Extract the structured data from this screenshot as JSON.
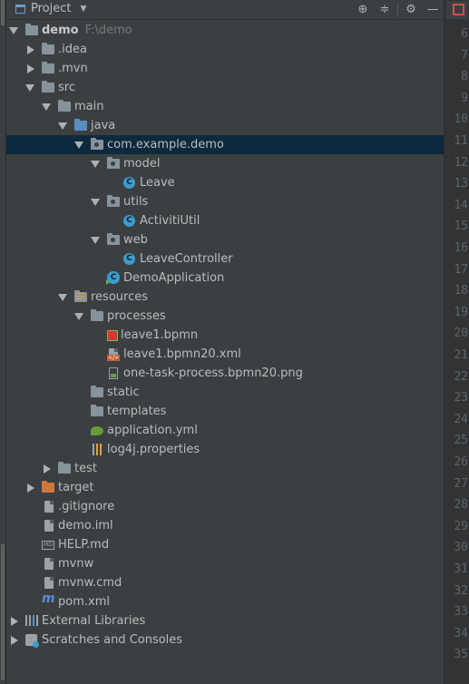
{
  "panel": {
    "title": "Project",
    "icons": [
      "locate-icon",
      "collapse-icon",
      "gear-icon",
      "hide-icon"
    ]
  },
  "tree": {
    "root": {
      "label": "demo",
      "path": "F:\\demo"
    },
    "idea": ".idea",
    "mvn": ".mvn",
    "src": "src",
    "main": "main",
    "java": "java",
    "package": "com.example.demo",
    "model": "model",
    "leave": "Leave",
    "utils": "utils",
    "activiti_util": "ActivitiUtil",
    "web": "web",
    "leave_controller": "LeaveController",
    "demo_application": "DemoApplication",
    "resources": "resources",
    "processes": "processes",
    "leave_bpmn": "leave1.bpmn",
    "leave_bpmn_xml": "leave1.bpmn20.xml",
    "png": "one-task-process.bpmn20.png",
    "static": "static",
    "templates": "templates",
    "app_yml": "application.yml",
    "log4j": "log4j.properties",
    "test": "test",
    "target": "target",
    "gitignore": ".gitignore",
    "demo_iml": "demo.iml",
    "help_md": "HELP.md",
    "mvnw": "mvnw",
    "mvnw_cmd": "mvnw.cmd",
    "pom_xml": "pom.xml",
    "external_libraries": "External Libraries",
    "scratches": "Scratches and Consoles"
  },
  "gutter": {
    "lines": [
      "6",
      "7",
      "8",
      "9",
      "10",
      "11",
      "12",
      "13",
      "14",
      "15",
      "16",
      "17",
      "18",
      "19",
      "20",
      "21",
      "22",
      "23",
      "24",
      "25",
      "26",
      "27",
      "28",
      "29",
      "30",
      "31",
      "32",
      "33",
      "34",
      "35"
    ]
  },
  "colors": {
    "selection": "#0d293e",
    "background": "#3c3f41",
    "text": "#bbbbbb"
  }
}
